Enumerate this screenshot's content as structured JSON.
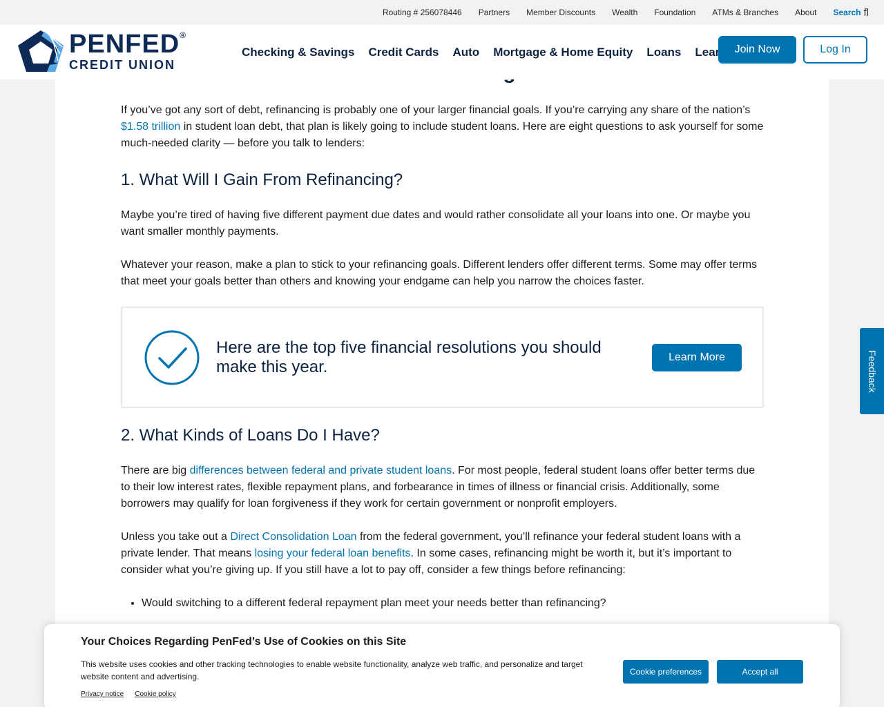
{
  "utility": {
    "routing": "Routing # 256078446",
    "links": [
      "Partners",
      "Member Discounts",
      "Wealth",
      "Foundation",
      "ATMs & Branches",
      "About"
    ],
    "search_label": "Search",
    "search_icon": "fl"
  },
  "logo": {
    "line1": "PENFED",
    "line2": "CREDIT UNION",
    "registered": "®"
  },
  "nav": [
    "Checking & Savings",
    "Credit Cards",
    "Auto",
    "Mortgage & Home Equity",
    "Loans",
    "Learn"
  ],
  "header_buttons": {
    "join": "Join Now",
    "login": "Log In"
  },
  "article": {
    "clipped_heading": "What to Ask Yourself About Refinancing",
    "intro": {
      "before": "If you’ve got any sort of debt, refinancing is probably one of your larger financial goals. If you’re carrying any share of the nation’s ",
      "link": "$1.58 trillion",
      "after": " in student loan debt, that plan is likely going to include student loans. Here are eight questions to ask yourself for some much-needed clarity — before you talk to lenders:"
    },
    "q1_heading": "1. What Will I Gain From Refinancing?",
    "q1_p1": "Maybe you’re tired of having five different payment due dates and would rather consolidate all your loans into one. Or maybe you want smaller monthly payments.",
    "q1_p2": "Whatever your reason, make a plan to stick to your refinancing goals. Different lenders offer different terms. Some may offer terms that meet your goals better than others and knowing your endgame can help you narrow the choices faster.",
    "callout": {
      "text": "Here are the top five financial resolutions you should make this year.",
      "button": "Learn More"
    },
    "q2_heading": "2. What Kinds of Loans Do I Have?",
    "q2_p1": {
      "before": "There are big ",
      "link": "differences between federal and private student loans",
      "after": ". For most people, federal student loans offer better terms due to their low interest rates, flexible repayment plans, and forbearance in times of illness or financial crisis. Additionally, some borrowers may qualify for loan forgiveness if they work for certain government or nonprofit employers."
    },
    "q2_p2": {
      "before": "Unless you take out a ",
      "link1": "Direct Consolidation Loan",
      "middle": " from the federal government, you’ll refinance your federal student loans with a private lender. That means ",
      "link2": "losing your federal loan benefits",
      "after": ". In some cases, refinancing might be worth it, but it’s important to consider what you’re giving up. If you still have a lot to pay off, consider a few things before refinancing:"
    },
    "bullets": [
      "Would switching to a different federal repayment plan meet your needs better than refinancing?"
    ]
  },
  "feedback": "Feedback",
  "cookie": {
    "title": "Your Choices Regarding PenFed’s Use of Cookies on this Site",
    "body": "This website uses cookies and other tracking technologies to enable website functionality, analyze web traffic, and personalize and target website content and advertising.",
    "links": [
      "Privacy notice",
      "Cookie policy"
    ],
    "preferences": "Cookie preferences",
    "accept": "Accept all"
  },
  "colors": {
    "brand": "#0073b1",
    "navy": "#0d2a56",
    "heading": "#0d2340"
  }
}
